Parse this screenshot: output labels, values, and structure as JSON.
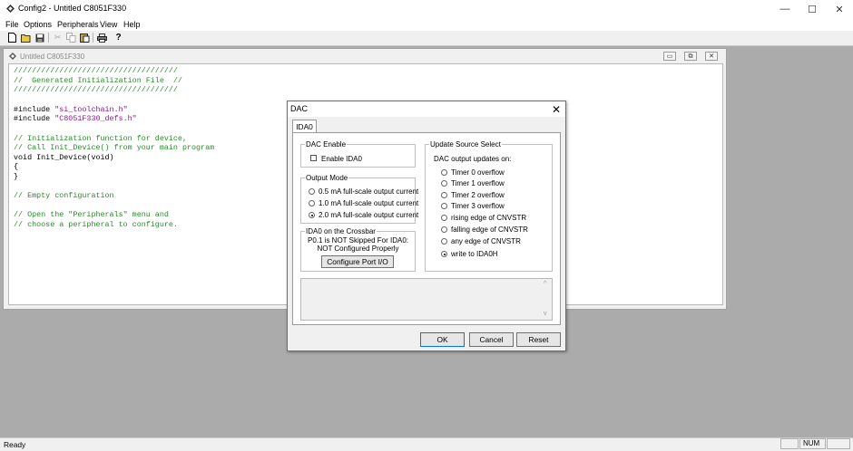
{
  "window": {
    "title": "Config2 - Untitled C8051F330"
  },
  "menu": [
    "File",
    "Options",
    "Peripherals",
    "View",
    "Help"
  ],
  "toolbar": {
    "icons": [
      "new-file-icon",
      "open-folder-icon",
      "save-icon",
      "cut-icon",
      "copy-icon",
      "paste-icon",
      "print-icon",
      "help-icon"
    ]
  },
  "child_window": {
    "title": "Untitled C8051F330",
    "code_lines": [
      "////////////////////////////////////",
      "//  Generated Initialization File  //",
      "////////////////////////////////////",
      "",
      "#include \"si_toolchain.h\"",
      "#include \"C8051F330_defs.h\"",
      "",
      "// Initialization function for device,",
      "// Call Init_Device() from your main program",
      "void Init_Device(void)",
      "{",
      "}",
      "",
      "// Empty configuration",
      "",
      "// Open the \"Peripherals\" menu and",
      "// choose a peripheral to configure."
    ]
  },
  "dialog": {
    "title": "DAC",
    "close_glyph": "✕",
    "tab": "IDA0",
    "dac_enable": {
      "group": "DAC Enable",
      "checkbox_label": "Enable IDA0",
      "checked": false
    },
    "output_mode": {
      "group": "Output Mode",
      "options": [
        "0.5 mA full-scale output current",
        "1.0 mA full-scale output current",
        "2.0 mA full-scale output current"
      ],
      "selected": "2.0 mA full-scale output current"
    },
    "crossbar": {
      "group": "IDA0 on the Crossbar",
      "line1": "P0.1 is NOT Skipped For IDA0:",
      "line2": "NOT Configured Properly",
      "button": "Configure Port I/O"
    },
    "update_source": {
      "group": "Update Source Select",
      "caption": "DAC output updates on:",
      "options": [
        "Timer 0 overflow",
        "Timer 1 overflow",
        "Timer 2 overflow",
        "Timer 3 overflow",
        "rising edge of CNVSTR",
        "falling edge of CNVSTR",
        "any edge of CNVSTR",
        "write to IDA0H"
      ],
      "selected": "write to IDA0H"
    },
    "buttons": {
      "ok": "OK",
      "cancel": "Cancel",
      "reset": "Reset"
    }
  },
  "statusbar": {
    "text": "Ready",
    "num": "NUM"
  }
}
